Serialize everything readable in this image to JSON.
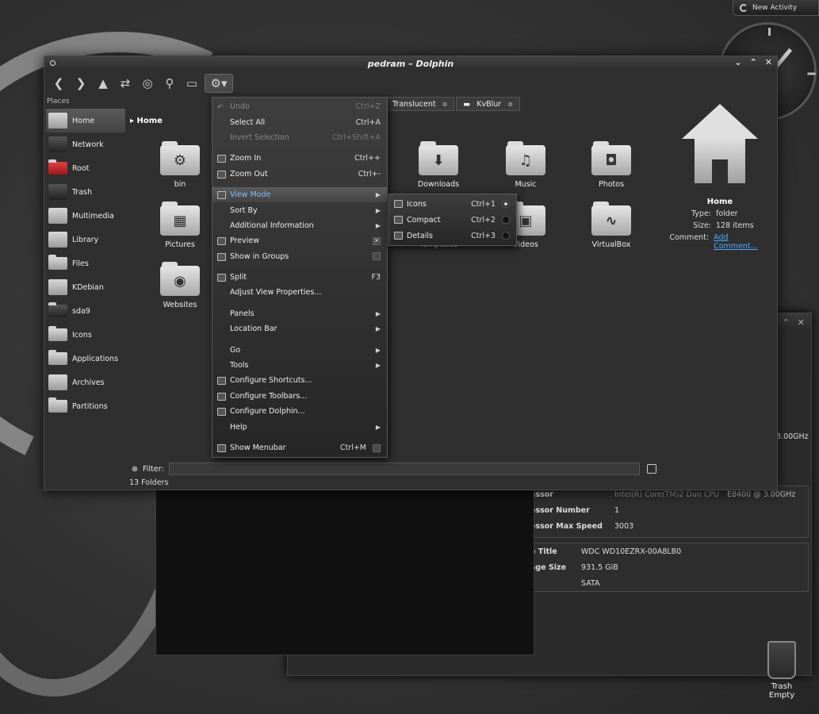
{
  "desktop": {
    "new_activity_label": "New Activity",
    "trash_label_line1": "Trash",
    "trash_label_line2": "Empty"
  },
  "window": {
    "title": "pedram – Dolphin",
    "buttons": [
      "⌄",
      "⌃",
      "✕"
    ]
  },
  "places": {
    "header": "Places",
    "items": [
      {
        "label": "Home"
      },
      {
        "label": "Network"
      },
      {
        "label": "Root"
      },
      {
        "label": "Trash"
      },
      {
        "label": "Multimedia"
      },
      {
        "label": "Library"
      },
      {
        "label": "Files"
      },
      {
        "label": "KDebian"
      },
      {
        "label": "sda9"
      },
      {
        "label": "Icons"
      },
      {
        "label": "Applications"
      },
      {
        "label": "Archives"
      },
      {
        "label": "Partitions"
      }
    ]
  },
  "breadcrumb": "Home",
  "tabs": [
    {
      "label": "Translucent"
    },
    {
      "label": "KvBlur"
    }
  ],
  "files": [
    {
      "label": "bin",
      "glyph": "⚙"
    },
    {
      "label": "Pictures",
      "glyph": "▦"
    },
    {
      "label": "Websites",
      "glyph": "◉"
    },
    {
      "label": "Downloads",
      "glyph": "⬇"
    },
    {
      "label": "Music",
      "glyph": "♫"
    },
    {
      "label": "Photos",
      "glyph": "◘"
    },
    {
      "label": "Templates",
      "glyph": "▤"
    },
    {
      "label": "Videos",
      "glyph": "▣"
    },
    {
      "label": "VirtualBox",
      "glyph": "∿"
    }
  ],
  "info_panel": {
    "title": "Home",
    "type_label": "Type:",
    "type_value": "folder",
    "size_label": "Size:",
    "size_value": "128 items",
    "comment_label": "Comment:",
    "comment_link": "Add Comment..."
  },
  "filter": {
    "label": "Filter:",
    "value": ""
  },
  "status": "13 Folders",
  "menu": {
    "items": [
      {
        "label": "Undo",
        "shortcut": "Ctrl+Z",
        "disabled": true
      },
      {
        "label": "Select All",
        "shortcut": "Ctrl+A"
      },
      {
        "label": "Invert Selection",
        "shortcut": "Ctrl+Shift+A",
        "disabled": true
      },
      {
        "label": "Zoom In",
        "shortcut": "Ctrl++"
      },
      {
        "label": "Zoom Out",
        "shortcut": "Ctrl+-"
      },
      {
        "label": "View Mode"
      },
      {
        "label": "Sort By"
      },
      {
        "label": "Additional Information"
      },
      {
        "label": "Preview"
      },
      {
        "label": "Show in Groups"
      },
      {
        "label": "Split",
        "shortcut": "F3"
      },
      {
        "label": "Adjust View Properties..."
      },
      {
        "label": "Panels"
      },
      {
        "label": "Location Bar"
      },
      {
        "label": "Go"
      },
      {
        "label": "Tools"
      },
      {
        "label": "Configure Shortcuts..."
      },
      {
        "label": "Configure Toolbars..."
      },
      {
        "label": "Configure Dolphin..."
      },
      {
        "label": "Help"
      },
      {
        "label": "Show Menubar",
        "shortcut": "Ctrl+M"
      }
    ]
  },
  "view_mode_submenu": {
    "items": [
      {
        "label": "Icons",
        "shortcut": "Ctrl+1"
      },
      {
        "label": "Compact",
        "shortcut": "Ctrl+2"
      },
      {
        "label": "Details",
        "shortcut": "Ctrl+3"
      }
    ]
  },
  "system_info": {
    "rows1": [
      {
        "key": "essor",
        "value": "Intel(R) Core(TM)2 Duo CPU",
        "value2": "E8400  @ 3.00GHz"
      },
      {
        "key": "essor Number",
        "value": "1"
      },
      {
        "key": "essor Max Speed",
        "value": "3003"
      }
    ],
    "rows2": [
      {
        "key": "e Title",
        "value": "WDC WD10EZRX-00A8LB0"
      },
      {
        "key": "age Size",
        "value": "931.5 GiB"
      },
      {
        "key": "",
        "value": "SATA"
      }
    ],
    "faded_value": "3.00GHz"
  },
  "colors": {
    "accent": "#7cc0ff",
    "link": "#4fa8ff"
  }
}
